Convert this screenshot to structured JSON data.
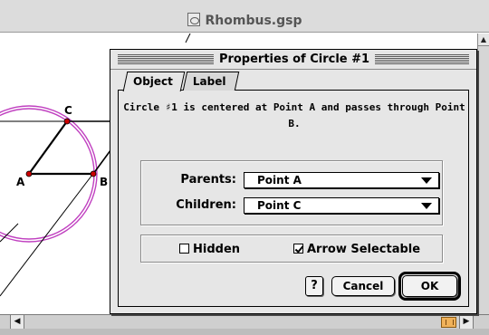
{
  "window": {
    "title": "Rhombus.gsp",
    "icon": "sketch-document-icon"
  },
  "canvas": {
    "point_labels": [
      "A",
      "B",
      "C"
    ]
  },
  "dialog": {
    "title": "Properties of Circle #1",
    "tabs": [
      {
        "label": "Object",
        "selected": true
      },
      {
        "label": "Label",
        "selected": false
      }
    ],
    "description": "Circle ♯1 is centered at Point A and passes through Point B.",
    "parents": {
      "label": "Parents:",
      "value": "Point A"
    },
    "children": {
      "label": "Children:",
      "value": "Point C"
    },
    "hidden": {
      "label": "Hidden",
      "checked": false
    },
    "arrow_selectable": {
      "label": "Arrow Selectable",
      "checked": true
    },
    "buttons": {
      "help": "?",
      "cancel": "Cancel",
      "ok": "OK"
    }
  },
  "colors": {
    "circle": "#c040c0",
    "point": "#cc0000"
  }
}
